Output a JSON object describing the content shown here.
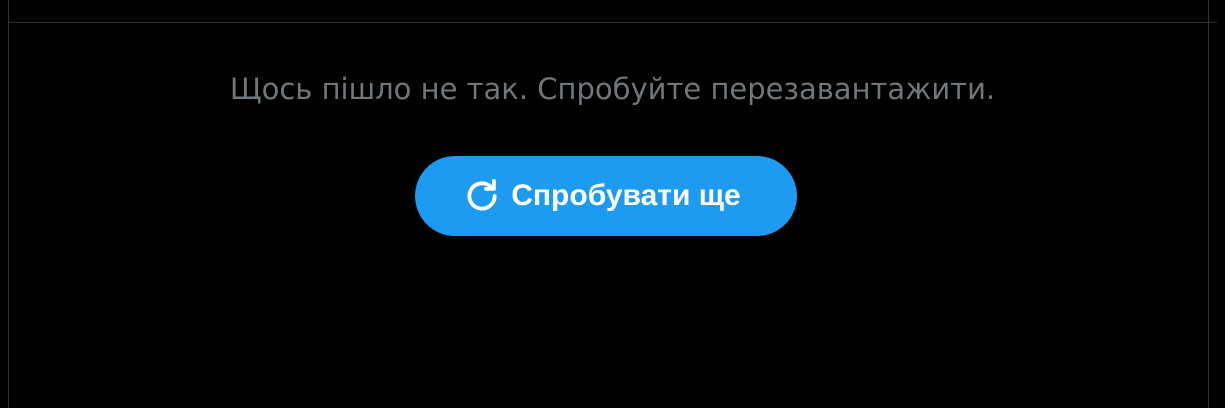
{
  "error": {
    "message": "Щось пішло не так. Спробуйте перезавантажити."
  },
  "retry": {
    "label": "Спробувати ще",
    "icon": "refresh-icon"
  },
  "colors": {
    "background": "#000000",
    "border": "#2f3336",
    "message_text": "#71767b",
    "button_bg": "#1d9bf0",
    "button_text": "#ffffff"
  }
}
